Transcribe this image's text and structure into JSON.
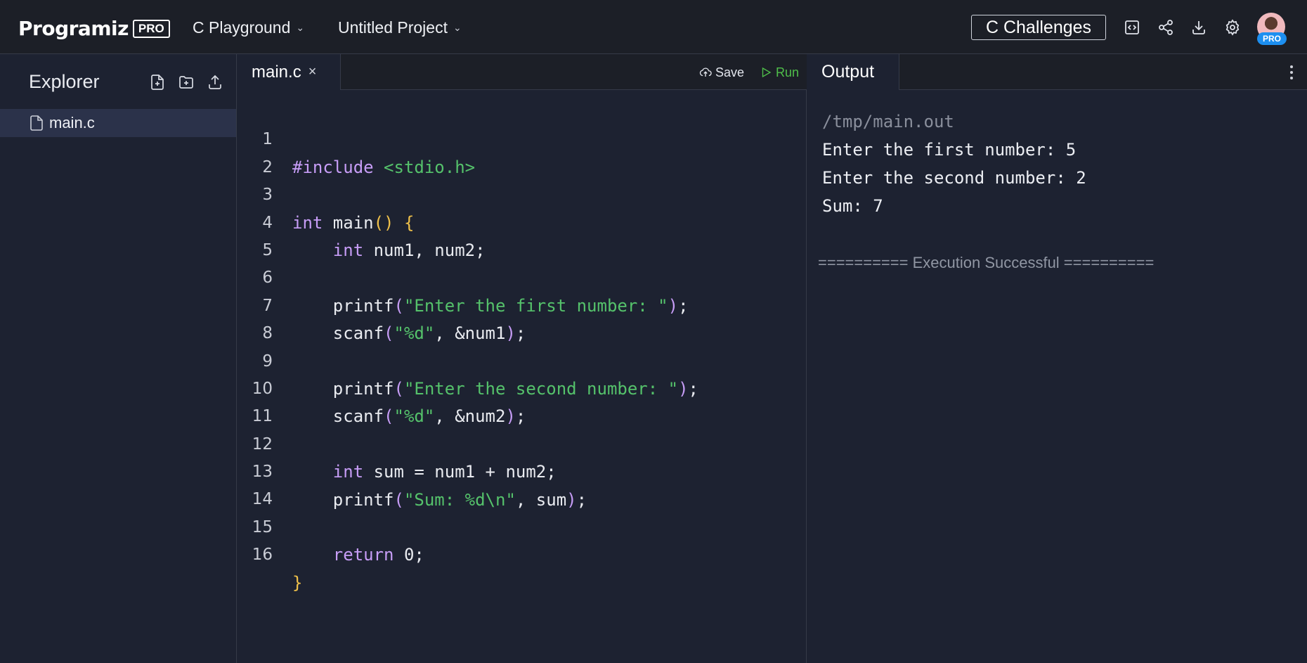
{
  "header": {
    "logo_text": "Programiz",
    "logo_badge": "PRO",
    "playground_label": "C Playground",
    "project_label": "Untitled Project",
    "challenges_label": "C Challenges",
    "icons": [
      "embed-code-icon",
      "share-icon",
      "download-icon",
      "settings-icon"
    ],
    "avatar_badge": "PRO",
    "badge_color": "#1d8ff0"
  },
  "explorer": {
    "title": "Explorer",
    "actions": [
      "new-file-icon",
      "new-folder-icon",
      "upload-icon"
    ],
    "files": [
      {
        "name": "main.c",
        "selected": true
      }
    ]
  },
  "editor": {
    "tabs": [
      {
        "label": "main.c",
        "close": "×"
      }
    ],
    "save_label": "Save",
    "run_label": "Run",
    "run_color": "#4fbf4a",
    "line_numbers": [
      "1",
      "2",
      "3",
      "4",
      "5",
      "6",
      "7",
      "8",
      "9",
      "10",
      "11",
      "12",
      "13",
      "14",
      "15",
      "16"
    ],
    "code": {
      "l1_pre": "#include ",
      "l1_hdr": "<stdio.h>",
      "l3_kw": "int",
      "l3_fn": " main",
      "l3_paren": "()",
      "l3_brace": " {",
      "l4_kw": "int",
      "l4_rest": " num1, num2;",
      "l6_fn": "printf",
      "l6_str": "\"Enter the first number: \"",
      "l6_end": ";",
      "l7_fn": "scanf",
      "l7_str": "\"%d\"",
      "l7_rest": ", &num1",
      "l7_end": ";",
      "l9_fn": "printf",
      "l9_str": "\"Enter the second number: \"",
      "l9_end": ";",
      "l10_fn": "scanf",
      "l10_str": "\"%d\"",
      "l10_rest": ", &num2",
      "l10_end": ";",
      "l12_kw": "int",
      "l12_rest": " sum = num1 + num2;",
      "l13_fn": "printf",
      "l13_str": "\"Sum: %d\\n\"",
      "l13_rest": ", sum",
      "l13_end": ";",
      "l15_kw": "return",
      "l15_rest": " 0;",
      "l16_brace": "}"
    }
  },
  "output": {
    "tab_label": "Output",
    "lines": [
      "/tmp/main.out",
      "Enter the first number: 5",
      "Enter the second number: 2",
      "Sum: 7"
    ],
    "status": "========== Execution Successful =========="
  }
}
